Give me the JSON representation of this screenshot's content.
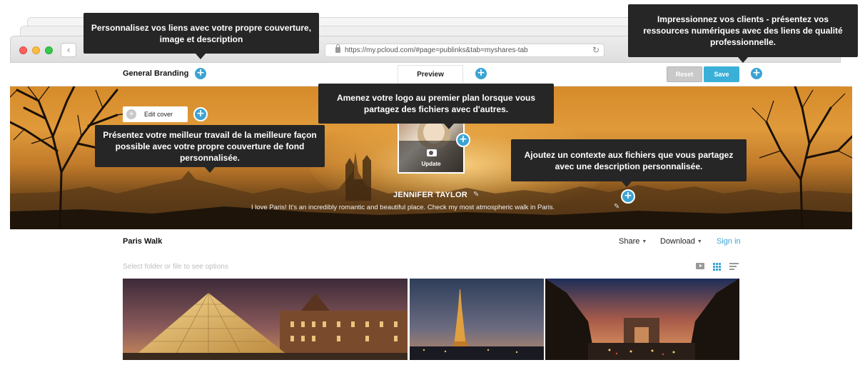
{
  "browser": {
    "url": "https://my.pcloud.com/#page=publinks&tab=myshares-tab",
    "back_icon": "chevron-left-icon",
    "reload_icon": "reload-icon"
  },
  "toolbar": {
    "general_branding": "General Branding",
    "preview_tab": "Preview",
    "reset_label": "Reset",
    "save_label": "Save"
  },
  "cover": {
    "edit_cover_label": "Edit cover",
    "update_label": "Update",
    "name": "JENNIFER TAYLOR",
    "description": "I love Paris! It's an incredibly romantic and beautiful place. Check my most atmospheric walk in Paris."
  },
  "tooltips": {
    "links": "Personnalisez vos liens avec votre propre couverture, image et description",
    "clients": "Impressionnez vos clients - présentez vos ressources numériques avec des liens de qualité professionnelle.",
    "logo": "Amenez votre logo au premier plan lorsque vous partagez des fichiers avec d'autres.",
    "cover": "Présentez votre meilleur travail de la meilleure façon possible avec votre propre couverture de fond personnalisée.",
    "context": "Ajoutez un contexte aux fichiers que vous partagez avec une description personnalisée."
  },
  "folder": {
    "title": "Paris Walk",
    "share_label": "Share",
    "download_label": "Download",
    "signin_label": "Sign in",
    "hint": "Select folder or file to see options",
    "views": [
      "slideshow-icon",
      "grid-view-icon",
      "list-view-icon"
    ]
  },
  "plus_glyph": "+",
  "colors": {
    "accent": "#3aa4d4",
    "save": "#3ab0d8",
    "tooltip_bg": "#262626"
  }
}
